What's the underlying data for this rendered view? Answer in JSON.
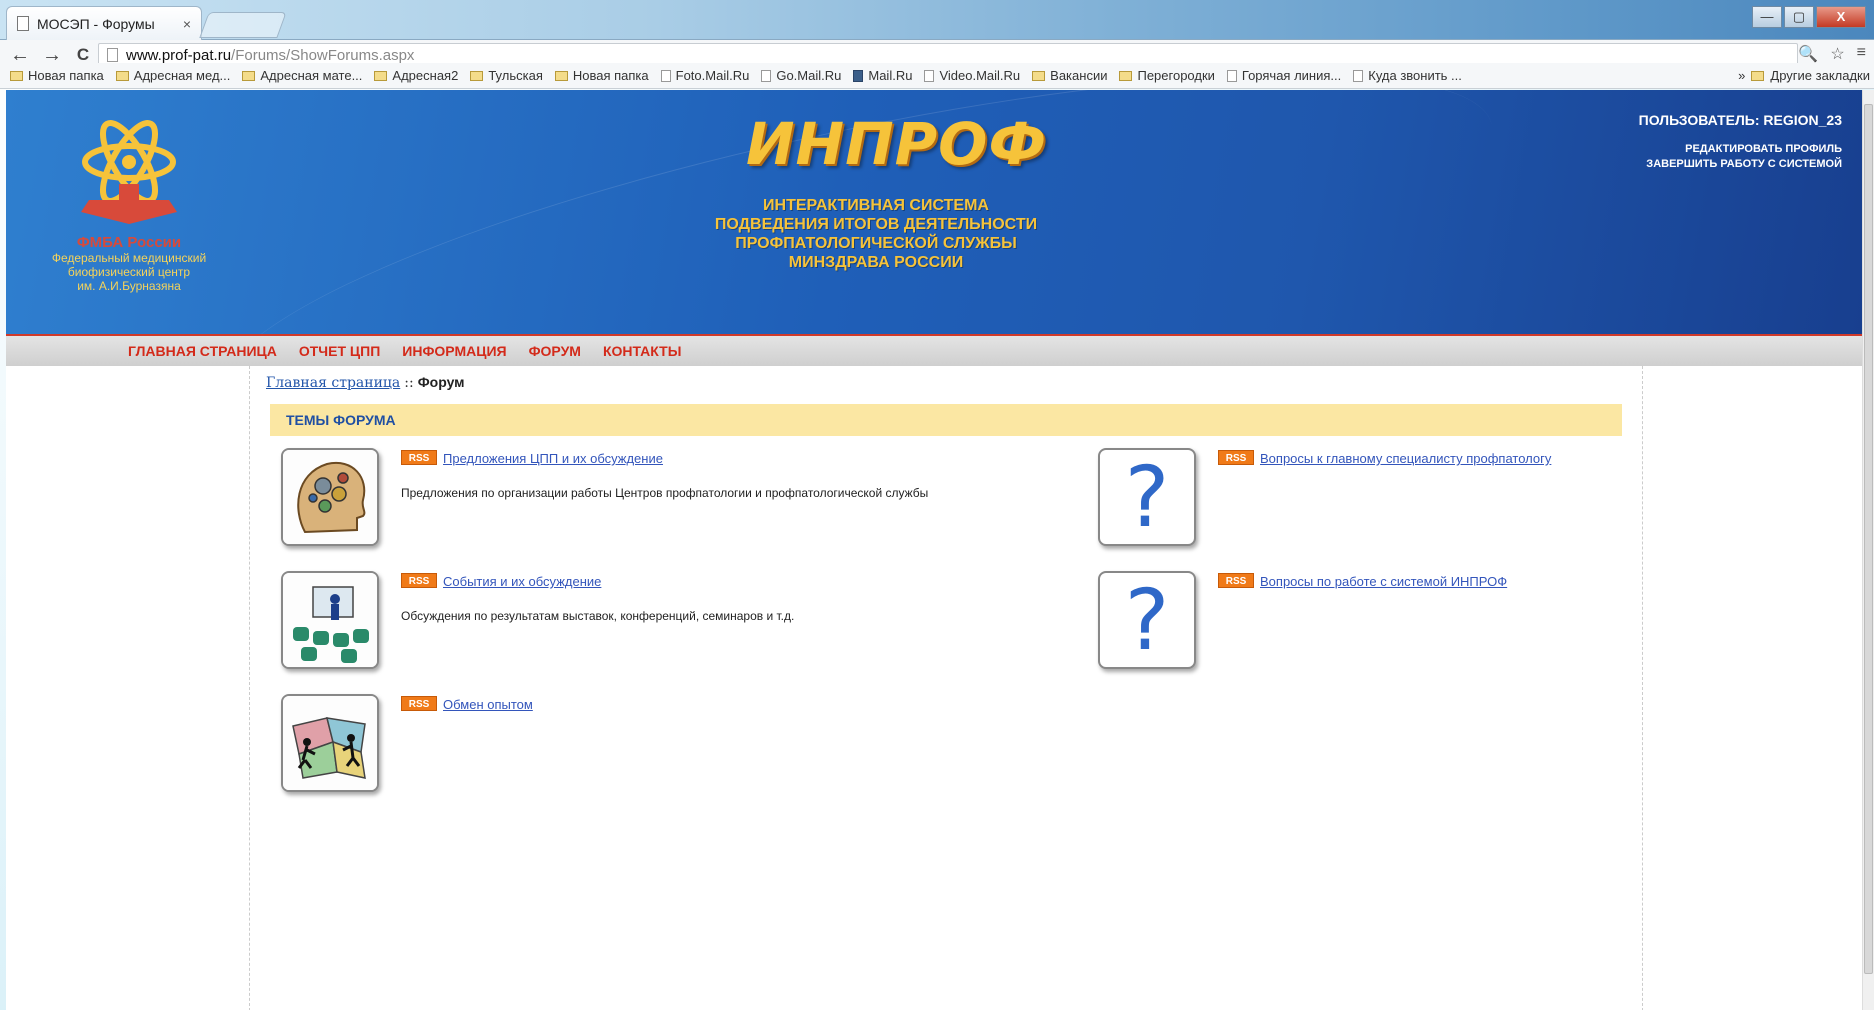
{
  "browser": {
    "tab_title": "МОСЭП - Форумы",
    "tab_close": "×",
    "url_host": "www.prof-pat.ru",
    "url_path": "/Forums/ShowForums.aspx",
    "back": "←",
    "forward": "→",
    "reload": "C",
    "zoom_icon": "🔍",
    "star_icon": "☆",
    "menu_icon": "≡",
    "window": {
      "min": "—",
      "max": "▢",
      "close": "X"
    },
    "bookmarks": [
      {
        "label": "Новая папка",
        "icon": "folder-icon"
      },
      {
        "label": "Адресная мед...",
        "icon": "folder-icon"
      },
      {
        "label": "Адресная мате...",
        "icon": "folder-icon"
      },
      {
        "label": "Адресная2",
        "icon": "folder-icon"
      },
      {
        "label": "Тульская",
        "icon": "folder-icon"
      },
      {
        "label": "Новая папка",
        "icon": "folder-icon"
      },
      {
        "label": "Foto.Mail.Ru",
        "icon": "page-icon"
      },
      {
        "label": "Go.Mail.Ru",
        "icon": "page-icon"
      },
      {
        "label": "Mail.Ru",
        "icon": "mail-icon"
      },
      {
        "label": "Video.Mail.Ru",
        "icon": "page-icon"
      },
      {
        "label": "Вакансии",
        "icon": "folder-icon"
      },
      {
        "label": "Перегородки",
        "icon": "folder-icon"
      },
      {
        "label": "Горячая линия...",
        "icon": "page-icon"
      },
      {
        "label": "Куда звонить ...",
        "icon": "page-icon"
      }
    ],
    "bookmarks_more": "»",
    "bookmarks_other": "Другие закладки"
  },
  "header": {
    "brand": "ИНПРОФ",
    "tagline": [
      "ИНТЕРАКТИВНАЯ СИСТЕМА",
      "ПОДВЕДЕНИЯ ИТОГОВ ДЕЯТЕЛЬНОСТИ",
      "ПРОФПАТОЛОГИЧЕСКОЙ СЛУЖБЫ",
      "МИНЗДРАВА РОССИИ"
    ],
    "logo_org": "ФМБА России",
    "logo_sub": [
      "Федеральный медицинский",
      "биофизический центр",
      "им. А.И.Бурназяна"
    ],
    "user": "ПОЛЬЗОВАТЕЛЬ: REGION_23",
    "edit_profile": "РЕДАКТИРОВАТЬ ПРОФИЛЬ",
    "logout": "ЗАВЕРШИТЬ РАБОТУ С СИСТЕМОЙ"
  },
  "nav": {
    "items": [
      "ГЛАВНАЯ СТРАНИЦА",
      "ОТЧЕТ ЦПП",
      "ИНФОРМАЦИЯ",
      "ФОРУМ",
      "КОНТАКТЫ"
    ]
  },
  "breadcrumb": {
    "home": "Главная страница",
    "sep": "::",
    "current": "Форум"
  },
  "section": {
    "title": "ТЕМЫ ФОРУМА"
  },
  "forums": [
    {
      "title": "Предложения ЦПП и их обсуждение",
      "desc": "Предложения по организации работы Центров профпатологии и профпатологической службы",
      "icon": "head-gears-icon",
      "rss": "RSS"
    },
    {
      "title": "Вопросы к главному специалисту профпатологу",
      "desc": "",
      "icon": "question-icon",
      "rss": "RSS",
      "qmark": "?"
    },
    {
      "title": "События и их обсуждение",
      "desc": "Обсуждения по результатам выставок, конференций, семинаров и т.д.",
      "icon": "conference-icon",
      "rss": "RSS"
    },
    {
      "title": "Вопросы по работе с системой ИНПРОФ",
      "desc": "",
      "icon": "question-icon",
      "rss": "RSS",
      "qmark": "?"
    },
    {
      "title": "Обмен опытом",
      "desc": "",
      "icon": "puzzle-people-icon",
      "rss": "RSS"
    }
  ],
  "colors": {
    "header_blue": "#1f5fb8",
    "brand_gold": "#f6c33a",
    "nav_red": "#d32a1a",
    "section_bar": "#fbe7a3",
    "link_blue": "#3355bb",
    "rss_orange": "#f07a18"
  }
}
